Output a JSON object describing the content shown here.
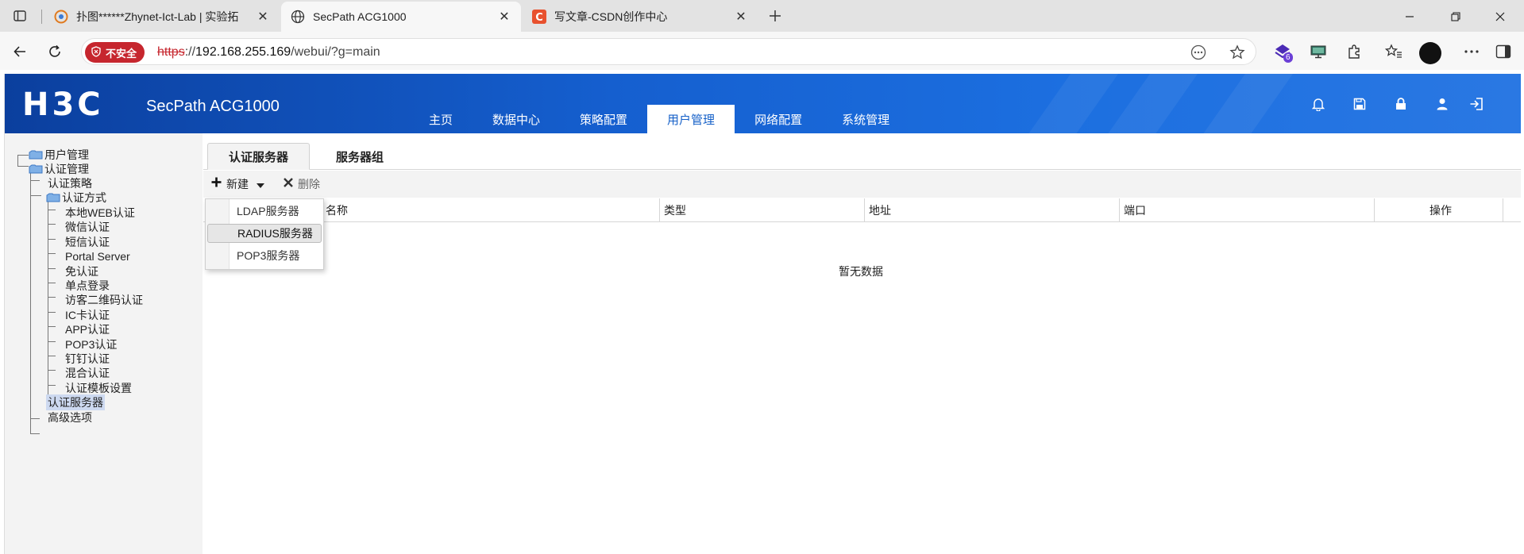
{
  "browser": {
    "tabs": [
      {
        "title": "扑图******Zhynet-Ict-Lab | 实验拓",
        "close": "✕"
      },
      {
        "title": "SecPath ACG1000",
        "close": "✕"
      },
      {
        "title": "写文章-CSDN创作中心",
        "close": "✕"
      }
    ],
    "security_label": "不安全",
    "url_scheme": "https",
    "url_sep": "://",
    "url_host": "192.168.255.169",
    "url_path": "/webui/?g=main",
    "extension_badge": "6"
  },
  "app": {
    "logo": "H3C",
    "product": "SecPath ACG1000",
    "nav": [
      "主页",
      "数据中心",
      "策略配置",
      "用户管理",
      "网络配置",
      "系统管理"
    ],
    "nav_active": "用户管理",
    "accent": "#1560c8"
  },
  "sidebar": {
    "root": "用户管理",
    "auth_mgmt": "认证管理",
    "auth_policy": "认证策略",
    "auth_method": "认证方式",
    "methods": [
      "本地WEB认证",
      "微信认证",
      "短信认证",
      "Portal Server",
      "免认证",
      "单点登录",
      "访客二维码认证",
      "IC卡认证",
      "APP认证",
      "POP3认证",
      "钉钉认证",
      "混合认证",
      "认证模板设置"
    ],
    "auth_server": "认证服务器",
    "advanced": "高级选项"
  },
  "content": {
    "tabs": [
      "认证服务器",
      "服务器组"
    ],
    "new_label": "新建",
    "delete_label": "删除",
    "columns": [
      "名称",
      "类型",
      "地址",
      "端口",
      "操作"
    ],
    "empty_text": "暂无数据"
  },
  "dropdown": {
    "items": [
      "LDAP服务器",
      "RADIUS服务器",
      "POP3服务器"
    ],
    "hovered": "RADIUS服务器"
  }
}
